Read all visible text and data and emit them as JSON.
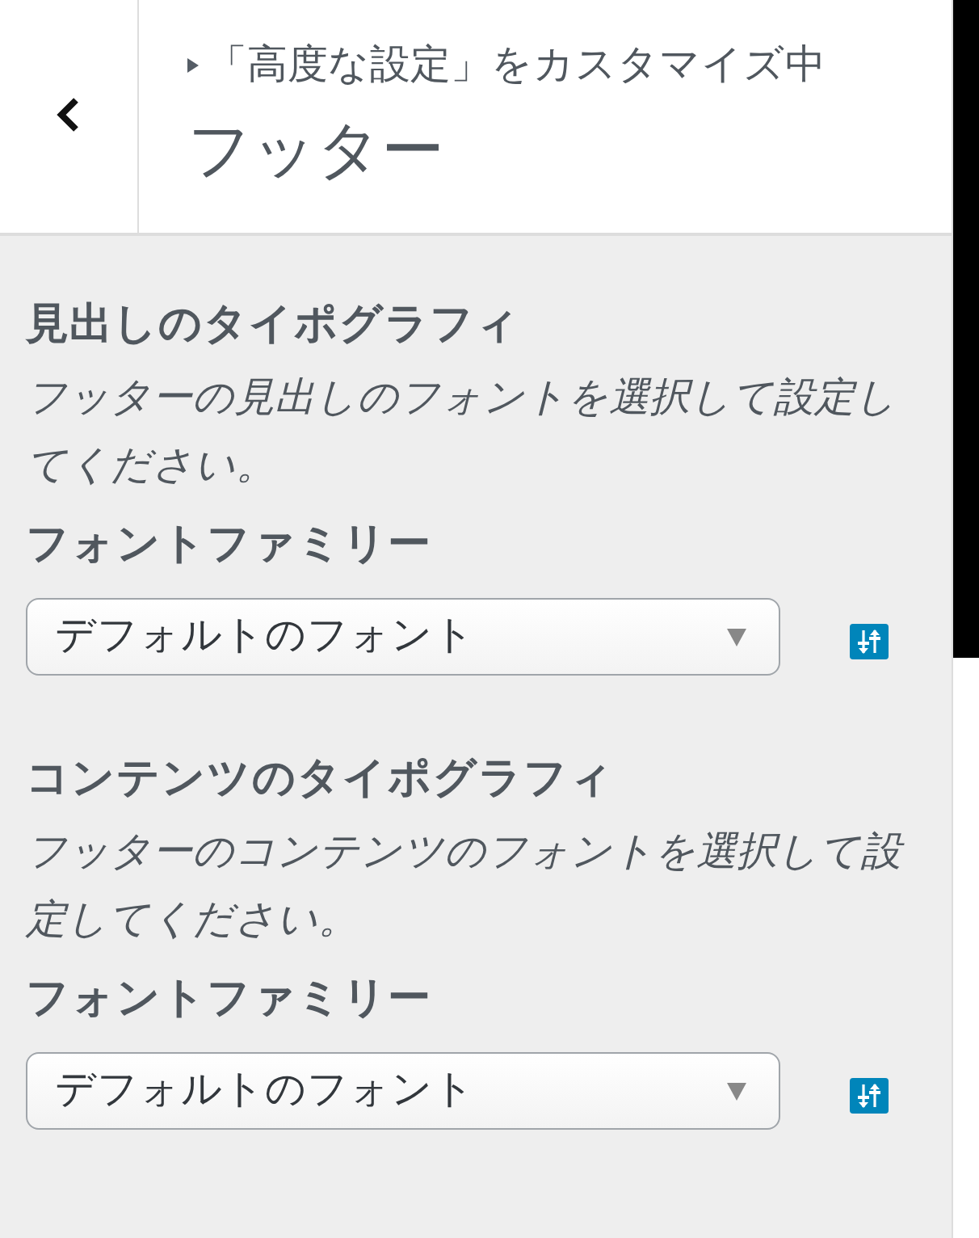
{
  "header": {
    "breadcrumb": "「高度な設定」をカスタマイズ中",
    "title": "フッター"
  },
  "sections": [
    {
      "heading": "見出しのタイポグラフィ",
      "description": "フッターの見出しのフォントを選択して設定してください。",
      "controls": [
        {
          "label": "フォントファミリー",
          "value": "デフォルトのフォント"
        }
      ]
    },
    {
      "heading": "コンテンツのタイポグラフィ",
      "description": "フッターのコンテンツのフォントを選択して設定してください。",
      "controls": [
        {
          "label": "フォントファミリー",
          "value": "デフォルトのフォント"
        }
      ]
    }
  ]
}
